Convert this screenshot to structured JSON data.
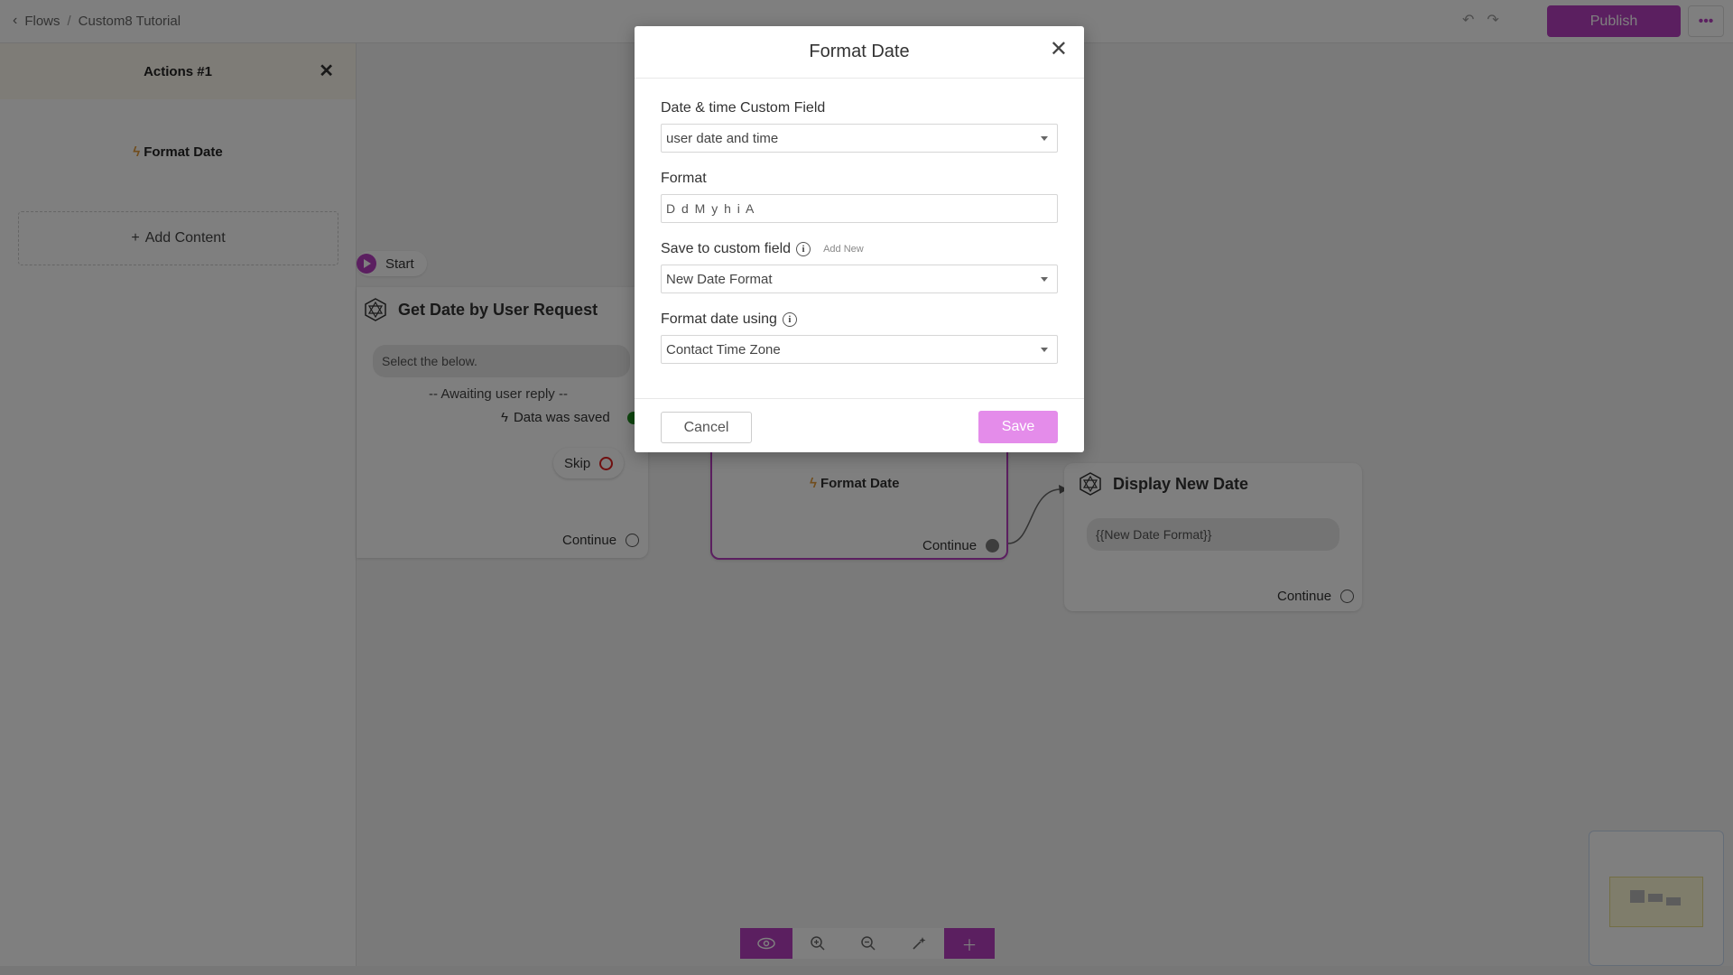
{
  "topbar": {
    "back_label": "Flows",
    "separator": "/",
    "flow_name": "Custom8 Tutorial",
    "publish_label": "Publish",
    "more_label": "•••",
    "undo_icon": "undo-icon",
    "redo_icon": "redo-icon"
  },
  "left_panel": {
    "title": "Actions #1",
    "close_glyph": "✕",
    "action_label": "Format Date",
    "add_content_label": "Add Content"
  },
  "canvas": {
    "start_label": "Start",
    "node1": {
      "title": "Get Date by User Request",
      "message": "Select the below.",
      "awaiting": "-- Awaiting user reply --",
      "saved": "Data was saved",
      "skip": "Skip",
      "continue": "Continue"
    },
    "node2": {
      "action": "Format Date",
      "continue": "Continue"
    },
    "node3": {
      "title": "Display New Date",
      "message": "{{New Date Format}}",
      "continue": "Continue"
    }
  },
  "modal": {
    "title": "Format Date",
    "close_glyph": "✕",
    "fields": {
      "datetime": {
        "label": "Date & time Custom Field",
        "value": "user date and time"
      },
      "format": {
        "label": "Format",
        "value": "D d M y h i A"
      },
      "save_to": {
        "label": "Save to custom field",
        "add_new": "Add New",
        "value": "New Date Format"
      },
      "using": {
        "label": "Format date using",
        "value": "Contact Time Zone"
      }
    },
    "cancel_label": "Cancel",
    "save_label": "Save"
  },
  "colors": {
    "accent": "#b73fc0",
    "save_button": "#e48cea",
    "bolt": "#e29b3b",
    "saved_dot": "#1e8f1e",
    "skip_ring": "#e02020"
  }
}
